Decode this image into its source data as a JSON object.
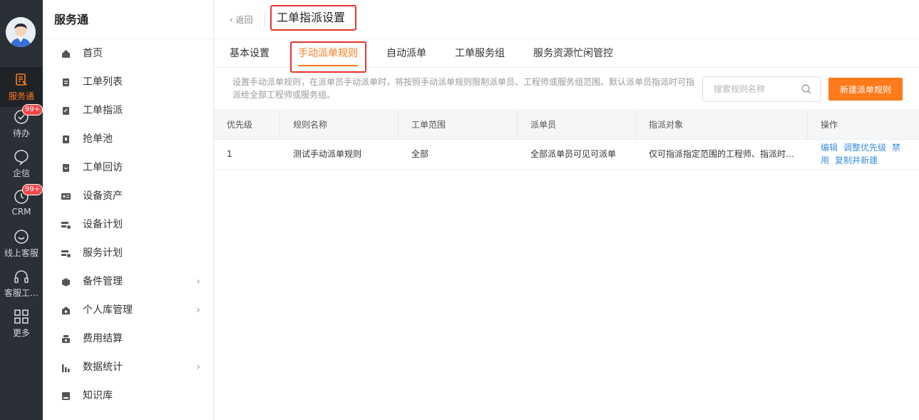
{
  "rail": {
    "items": [
      {
        "label": "服务通",
        "icon": "service-icon",
        "active": true
      },
      {
        "label": "待办",
        "icon": "todo-check-icon",
        "badge": "99+"
      },
      {
        "label": "企信",
        "icon": "chat-bubble-icon"
      },
      {
        "label": "CRM",
        "icon": "clock-icon",
        "badge": "99+"
      },
      {
        "label": "线上客服",
        "icon": "smile-chat-icon"
      },
      {
        "label": "客服工…",
        "icon": "headset-icon"
      },
      {
        "label": "更多",
        "icon": "grid-icon"
      }
    ]
  },
  "sidebar": {
    "title": "服务通",
    "items": [
      {
        "label": "首页",
        "icon": "home-icon"
      },
      {
        "label": "工单列表",
        "icon": "clipboard-icon"
      },
      {
        "label": "工单指派",
        "icon": "assign-icon"
      },
      {
        "label": "抢单池",
        "icon": "grab-icon"
      },
      {
        "label": "工单回访",
        "icon": "revisit-icon"
      },
      {
        "label": "设备资产",
        "icon": "device-icon"
      },
      {
        "label": "设备计划",
        "icon": "device-plan-icon"
      },
      {
        "label": "服务计划",
        "icon": "service-plan-icon"
      },
      {
        "label": "备件管理",
        "icon": "box-icon",
        "chevron": true
      },
      {
        "label": "个人库管理",
        "icon": "warehouse-icon",
        "chevron": true
      },
      {
        "label": "费用结算",
        "icon": "money-icon"
      },
      {
        "label": "数据统计",
        "icon": "bar-chart-icon",
        "chevron": true
      },
      {
        "label": "知识库",
        "icon": "book-icon"
      }
    ]
  },
  "header": {
    "back_label": "返回",
    "title": "工单指派设置"
  },
  "tabs": [
    {
      "label": "基本设置"
    },
    {
      "label": "手动派单规则",
      "active": true
    },
    {
      "label": "自动派单"
    },
    {
      "label": "工单服务组"
    },
    {
      "label": "服务资源忙闲管控"
    }
  ],
  "description": "设置手动派单规则，在派单员手动派单时，将按照手动派单规则限制派单员、工程师或服务组范围。默认派单员指派时可指派给全部工程师或服务组。",
  "search": {
    "placeholder": "搜索规则名称",
    "value": ""
  },
  "new_button_label": "新建派单规则",
  "table": {
    "columns": [
      "优先级",
      "规则名称",
      "工单范围",
      "派单员",
      "指派对象",
      "操作"
    ],
    "rows": [
      {
        "priority": "1",
        "name": "测试手动派单规则",
        "scope": "全部",
        "dispatcher": "全部派单员可见可派单",
        "target": "仅可指派指定范围的工程师、指派时…",
        "actions": [
          "编辑",
          "调整优先级",
          "禁用",
          "复制并新建"
        ]
      }
    ]
  },
  "colors": {
    "accent": "#ff7a1a",
    "link": "#3b8ee0",
    "highlight_box": "#e8322c",
    "rail_bg": "#2b2f36"
  }
}
